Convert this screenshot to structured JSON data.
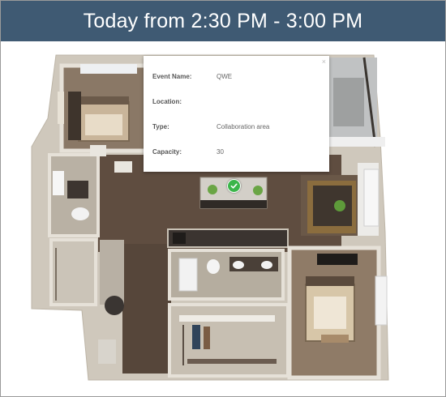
{
  "header": {
    "title": "Today from 2:30 PM - 3:00 PM"
  },
  "popup": {
    "close_icon": "×",
    "fields": [
      {
        "label": "Event Name:",
        "value": "QWE"
      },
      {
        "label": "Location:",
        "value": ""
      },
      {
        "label": "Type:",
        "value": "Collaboration area"
      },
      {
        "label": "Capacity:",
        "value": "30"
      }
    ]
  },
  "marker": {
    "icon": "check-icon",
    "color": "#3bb54a"
  },
  "colors": {
    "header_bg": "#3f5a73",
    "wall": "#d9d3c8",
    "floor_wood": "#5a4a3e",
    "tile": "#b7aea0"
  }
}
